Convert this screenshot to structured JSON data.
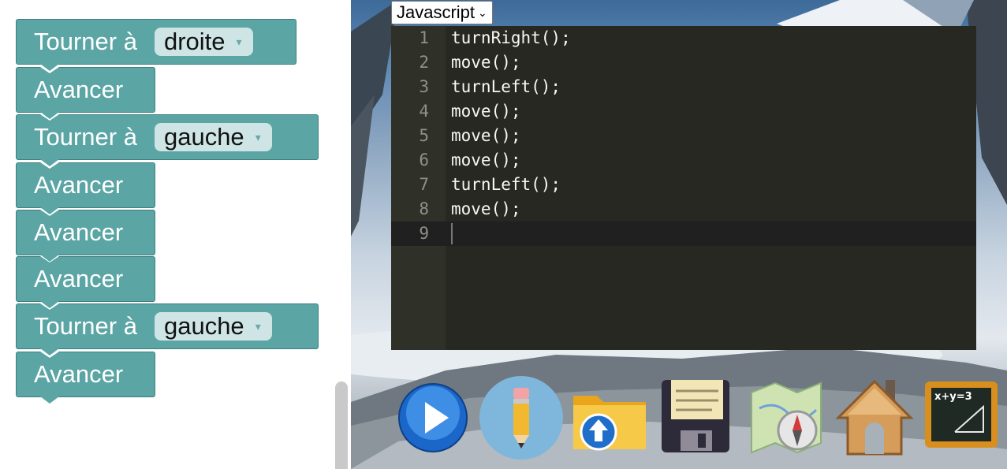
{
  "workspace": {
    "blocks": [
      {
        "type": "turn",
        "label": "Tourner à",
        "value": "droite"
      },
      {
        "type": "move",
        "label": "Avancer"
      },
      {
        "type": "turn",
        "label": "Tourner à",
        "value": "gauche"
      },
      {
        "type": "move",
        "label": "Avancer"
      },
      {
        "type": "move",
        "label": "Avancer"
      },
      {
        "type": "move",
        "label": "Avancer"
      },
      {
        "type": "turn",
        "label": "Tourner à",
        "value": "gauche"
      },
      {
        "type": "move",
        "label": "Avancer"
      }
    ],
    "dropdown_arrow": "▾"
  },
  "editor": {
    "language": "Javascript",
    "language_chevron": "⌄",
    "lines": [
      {
        "n": "1",
        "code": "turnRight();"
      },
      {
        "n": "2",
        "code": "move();"
      },
      {
        "n": "3",
        "code": "turnLeft();"
      },
      {
        "n": "4",
        "code": "move();"
      },
      {
        "n": "5",
        "code": "move();"
      },
      {
        "n": "6",
        "code": "move();"
      },
      {
        "n": "7",
        "code": "turnLeft();"
      },
      {
        "n": "8",
        "code": "move();"
      },
      {
        "n": "9",
        "code": ""
      }
    ],
    "active_line": "9"
  },
  "dock": {
    "items": [
      {
        "name": "play-icon"
      },
      {
        "name": "pencil-icon"
      },
      {
        "name": "folder-upload-icon"
      },
      {
        "name": "save-floppy-icon"
      },
      {
        "name": "map-compass-icon"
      },
      {
        "name": "home-icon"
      },
      {
        "name": "math-blackboard-icon",
        "text": "x+y=3"
      }
    ]
  },
  "colors": {
    "block": "#5ba5a5",
    "block_border": "#3f7f7f",
    "editor_bg": "#272822",
    "gutter_bg": "#2f3129"
  }
}
